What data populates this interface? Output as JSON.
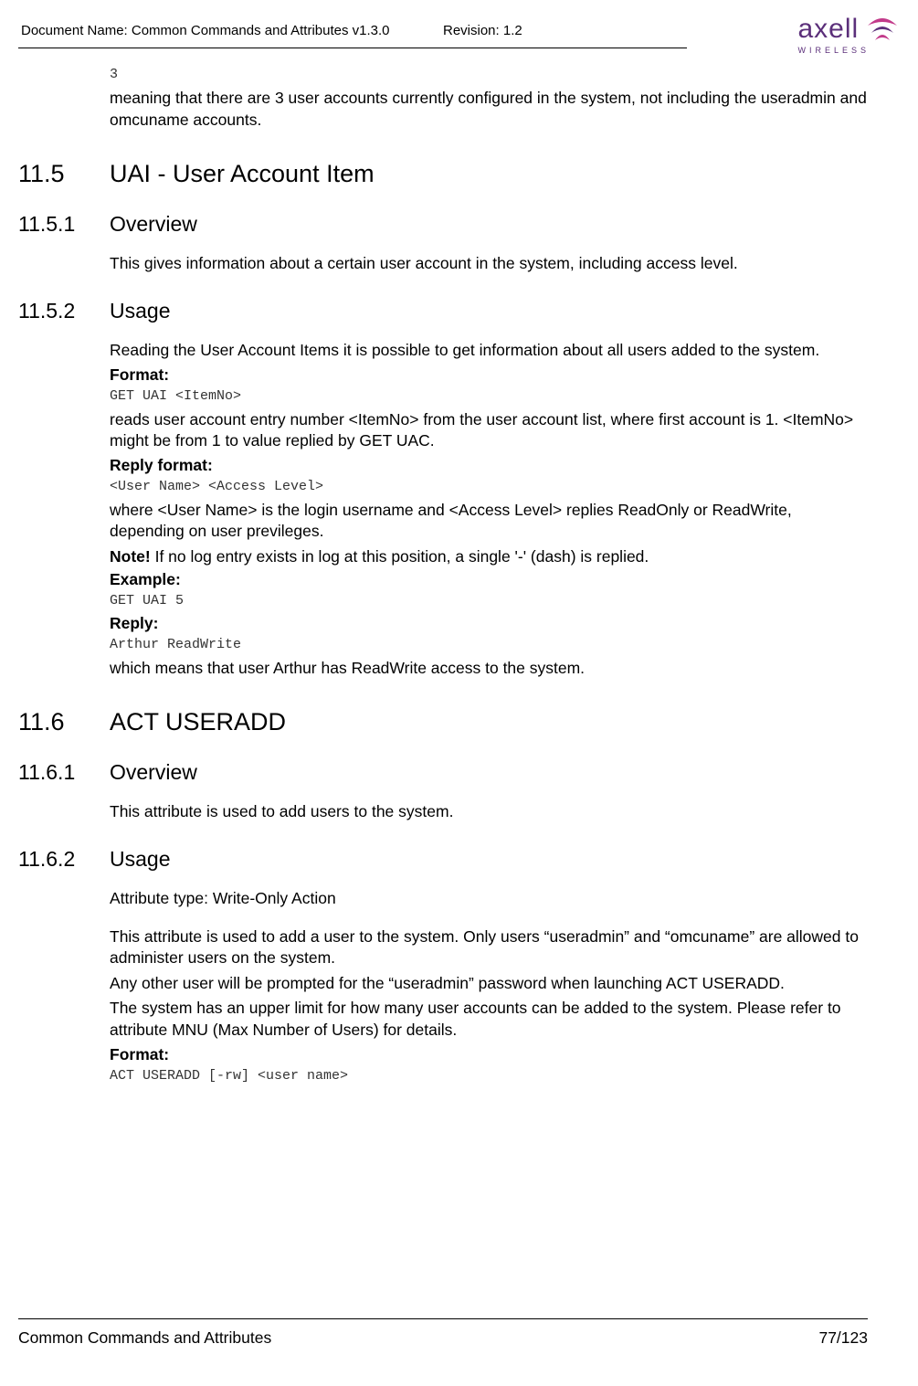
{
  "header": {
    "doc_name_label": "Document Name: Common Commands and Attributes v1.3.0",
    "revision_label": "Revision: 1.2",
    "logo_text": "axell",
    "logo_sub": "WIRELESS"
  },
  "intro": {
    "code_3": "3",
    "meaning_text": "meaning that there are 3 user accounts currently configured in the system, not including the useradmin and omcuname accounts."
  },
  "s115": {
    "num": "11.5",
    "title": "UAI - User Account Item"
  },
  "s1151": {
    "num": "11.5.1",
    "title": "Overview",
    "text": "This gives information about a certain user account in the system, including access level."
  },
  "s1152": {
    "num": "11.5.2",
    "title": "Usage",
    "intro": "Reading the User Account Items it is possible to get information about all users added to the system.",
    "format_label": "Format:",
    "format_code": "GET UAI <ItemNo>",
    "format_desc": "reads user account entry number <ItemNo> from the user account list, where first account is 1. <ItemNo> might be from 1 to value replied by GET UAC.",
    "reply_format_label": "Reply format:",
    "reply_format_code": "<User Name> <Access Level>",
    "reply_desc": "where <User Name> is the login username and <Access Level> replies ReadOnly or ReadWrite, depending on user previleges.",
    "note_bold": "Note!",
    "note_text": " If no log entry exists in log at this position, a single '-' (dash) is replied.",
    "example_label": "Example:",
    "example_code": "GET UAI 5",
    "reply_label": "Reply:",
    "reply_code": "Arthur ReadWrite",
    "reply_meaning": "which means that user Arthur has ReadWrite access to the system."
  },
  "s116": {
    "num": "11.6",
    "title": "ACT USERADD"
  },
  "s1161": {
    "num": "11.6.1",
    "title": "Overview",
    "text": "This attribute is used to add users to the system."
  },
  "s1162": {
    "num": "11.6.2",
    "title": "Usage",
    "attr_type": "Attribute type: Write-Only Action",
    "p1": "This attribute is used to add a user to the system. Only users “useradmin” and “omcuname” are allowed to administer users on the system.",
    "p2": "Any other user will be prompted for the “useradmin” password when launching ACT USERADD.",
    "p3": "The system has an upper limit for how many user accounts can be added to the system. Please refer to attribute MNU (Max Number of Users) for details.",
    "format_label": "Format:",
    "format_code": "ACT USERADD [-rw] <user name>"
  },
  "footer": {
    "left": "Common Commands and Attributes",
    "right": "77/123"
  }
}
